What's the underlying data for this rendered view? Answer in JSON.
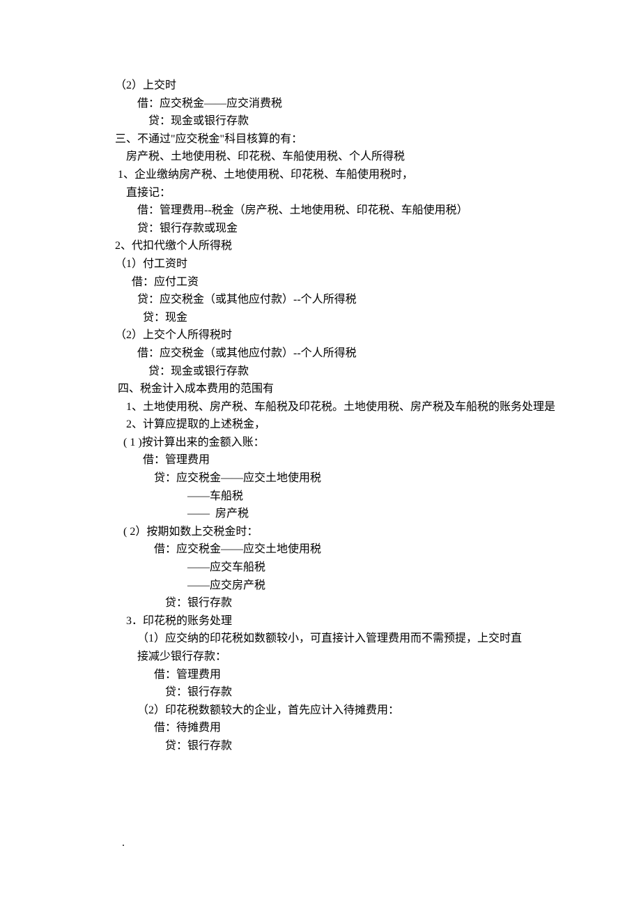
{
  "lines": [
    "（2）上交时",
    "        借：应交税金——应交消费税",
    "            贷：现金或银行存款",
    "三、不通过\"应交税金\"科目核算的有：",
    "    房产税、土地使用税、印花税、车船使用税、个人所得税",
    "",
    " 1、企业缴纳房产税、土地使用税、印花税、车船使用税时，",
    "    直接记：",
    "        借：管理费用--税金（房产税、土地使用税、印花税、车船使用税）",
    "        贷：银行存款或现金",
    "2、代扣代缴个人所得税",
    "",
    "（1）付工资时",
    "      借：应付工资",
    "        贷：应交税金（或其他应付款）--个人所得税",
    "          贷：现金",
    "（2）上交个人所得税时",
    "        借：应交税金（或其他应付款）--个人所得税",
    "            贷：现金或银行存款",
    "",
    " 四、税金计入成本费用的范围有",
    "    1、土地使用税、房产税、车船税及印花税。土地使用税、房产税及车船税的账务处理是",
    "",
    "    2、计算应提取的上述税金，",
    "",
    "   ( 1 )按计算出来的金额入账：",
    "          借：管理费用",
    "              贷：应交税金――应交土地使用税",
    "                          ――车船税",
    "                          ――  房产税",
    "   ( 2）按期如数上交税金时：",
    "              借：应交税金――应交土地使用税",
    "                          ――应交车船税",
    "                          ――应交房产税",
    "                  贷：银行存款",
    "    3．印花税的账务处理",
    "        （1）应交纳的印花税如数额较小，可直接计入管理费用而不需预提，上交时直",
    "        接减少银行存款：",
    "              借：管理费用",
    "                  贷：银行存款",
    "        （2）印花税数额较大的企业，首先应计入待摊费用：",
    "              借：待摊费用",
    "                  贷：银行存款"
  ],
  "footer": "."
}
